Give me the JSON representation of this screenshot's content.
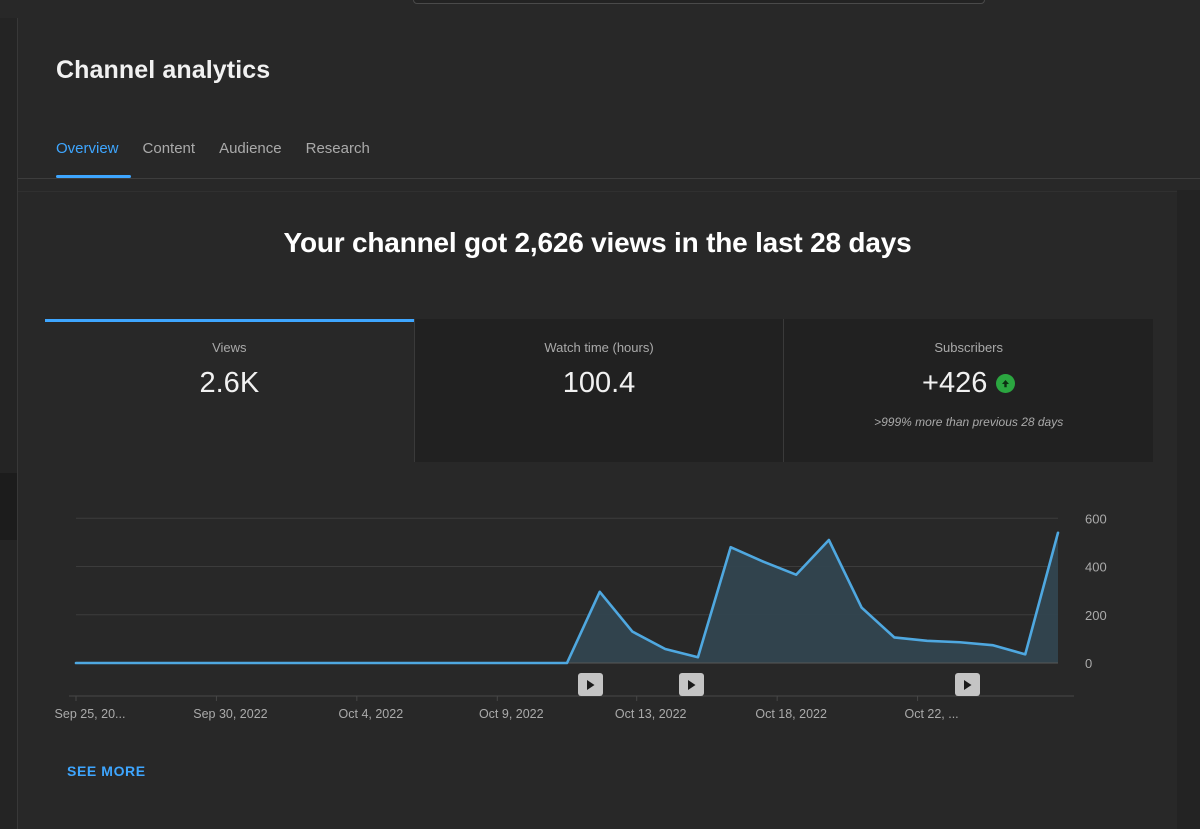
{
  "header": {
    "title": "Channel analytics",
    "tabs": [
      {
        "label": "Overview",
        "active": true
      },
      {
        "label": "Content",
        "active": false
      },
      {
        "label": "Audience",
        "active": false
      },
      {
        "label": "Research",
        "active": false
      }
    ]
  },
  "main": {
    "headline": "Your channel got 2,626 views in the last 28 days",
    "see_more_label": "SEE MORE",
    "metric_cards": [
      {
        "label": "Views",
        "value": "2.6K",
        "subtext": "",
        "active": true,
        "trend": ""
      },
      {
        "label": "Watch time (hours)",
        "value": "100.4",
        "subtext": "",
        "active": false,
        "trend": ""
      },
      {
        "label": "Subscribers",
        "value": "+426",
        "subtext": ">999% more than previous 28 days",
        "active": false,
        "trend": "up-arrow-icon"
      }
    ],
    "video_markers": [
      {
        "name": "video-marker-1",
        "icon": "play-icon",
        "x_pct": 52.3
      },
      {
        "name": "video-marker-2",
        "icon": "play-icon",
        "x_pct": 62.6
      },
      {
        "name": "video-marker-3",
        "icon": "play-icon",
        "x_pct": 90.7
      }
    ]
  },
  "colors": {
    "accent_blue": "#3ea6ff",
    "line_blue": "#4fa8e0",
    "trend_green": "#2ba640",
    "background": "#282828",
    "card_background": "#212121",
    "text_primary": "#f1f1f1",
    "text_secondary": "#aaaaaa"
  },
  "chart_data": {
    "type": "area",
    "title": "",
    "xlabel": "",
    "ylabel": "",
    "ylim": [
      0,
      680
    ],
    "yticks": [
      0,
      200,
      400,
      600
    ],
    "grid": true,
    "legend": "none",
    "xtick_labels": [
      "Sep 25, 20...",
      "Sep 30, 2022",
      "Oct 4, 2022",
      "Oct 9, 2022",
      "Oct 13, 2022",
      "Oct 18, 2022",
      "Oct 22, ..."
    ],
    "xtick_positions_pct": [
      0,
      14.3,
      28.6,
      42.9,
      57.1,
      71.4,
      85.7
    ],
    "x": [
      "Sep 25",
      "Sep 26",
      "Sep 27",
      "Sep 28",
      "Sep 29",
      "Sep 30",
      "Oct 1",
      "Oct 2",
      "Oct 3",
      "Oct 4",
      "Oct 5",
      "Oct 6",
      "Oct 7",
      "Oct 8",
      "Oct 9",
      "Oct 10",
      "Oct 11",
      "Oct 12",
      "Oct 13",
      "Oct 14",
      "Oct 15",
      "Oct 16",
      "Oct 17",
      "Oct 18",
      "Oct 19",
      "Oct 20",
      "Oct 21",
      "Oct 22"
    ],
    "series": [
      {
        "name": "Views",
        "color": "#4fa8e0",
        "values": [
          0,
          0,
          0,
          0,
          0,
          0,
          0,
          0,
          0,
          0,
          0,
          0,
          0,
          0,
          0,
          0,
          295,
          130,
          58,
          24,
          480,
          420,
          366,
          510,
          230,
          106,
          92,
          86,
          74,
          36,
          540
        ]
      }
    ]
  }
}
